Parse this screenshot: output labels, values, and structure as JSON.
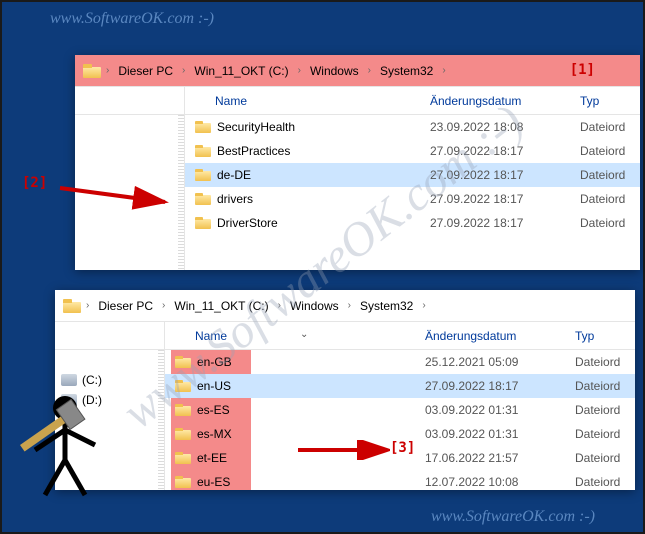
{
  "watermark": "www.SoftwareOK.com :-)",
  "annotations": {
    "a1": "[1]",
    "a2": "[2]",
    "a3": "[3]"
  },
  "breadcrumb": {
    "items": [
      "Dieser PC",
      "Win_11_OKT (C:)",
      "Windows",
      "System32"
    ]
  },
  "columns": {
    "name": "Name",
    "date": "Änderungsdatum",
    "type": "Typ"
  },
  "sidebar": {
    "drive_c": "(C:)",
    "drive_d": "(D:)"
  },
  "explorer1": {
    "rows": [
      {
        "name": "SecurityHealth",
        "date": "23.09.2022 18:08",
        "type": "Dateiord",
        "selected": false
      },
      {
        "name": "BestPractices",
        "date": "27.09.2022 18:17",
        "type": "Dateiord",
        "selected": false
      },
      {
        "name": "de-DE",
        "date": "27.09.2022 18:17",
        "type": "Dateiord",
        "selected": true
      },
      {
        "name": "drivers",
        "date": "27.09.2022 18:17",
        "type": "Dateiord",
        "selected": false
      },
      {
        "name": "DriverStore",
        "date": "27.09.2022 18:17",
        "type": "Dateiord",
        "selected": false
      }
    ]
  },
  "explorer2": {
    "rows": [
      {
        "name": "en-GB",
        "date": "25.12.2021 05:09",
        "type": "Dateiord",
        "selected": false
      },
      {
        "name": "en-US",
        "date": "27.09.2022 18:17",
        "type": "Dateiord",
        "selected": true
      },
      {
        "name": "es-ES",
        "date": "03.09.2022 01:31",
        "type": "Dateiord",
        "selected": false
      },
      {
        "name": "es-MX",
        "date": "03.09.2022 01:31",
        "type": "Dateiord",
        "selected": false
      },
      {
        "name": "et-EE",
        "date": "17.06.2022 21:57",
        "type": "Dateiord",
        "selected": false
      },
      {
        "name": "eu-ES",
        "date": "12.07.2022 10:08",
        "type": "Dateiord",
        "selected": false
      }
    ]
  },
  "type_label": "Dateiord"
}
